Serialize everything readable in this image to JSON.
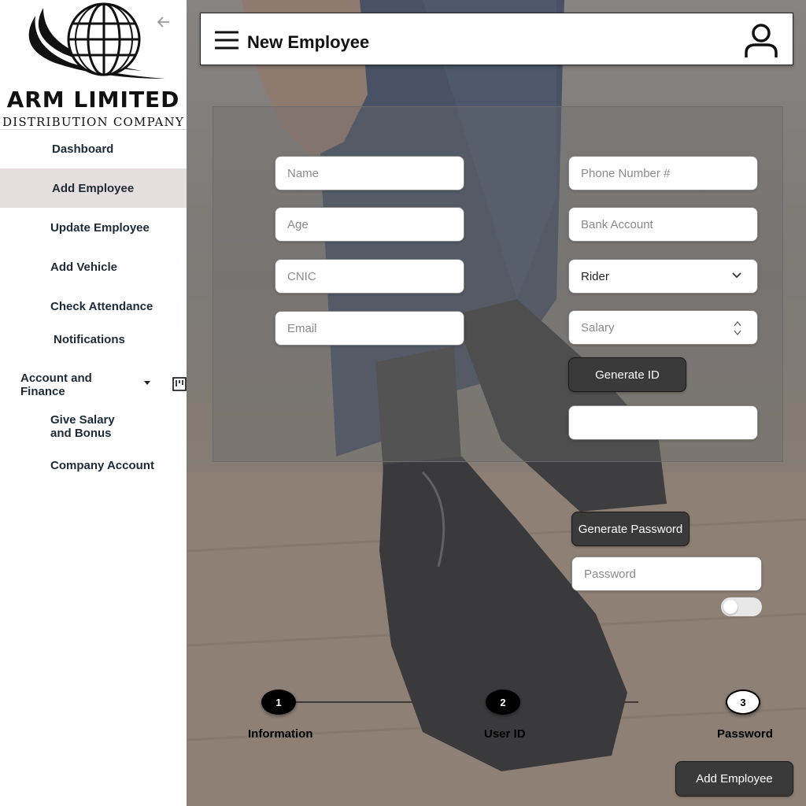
{
  "brand": {
    "name": "ARM LIMITED",
    "subtitle": "DISTRIBUTION COMPANY"
  },
  "sidebar": {
    "items": [
      {
        "label": "Dashboard"
      },
      {
        "label": "Add Employee"
      },
      {
        "label": "Update Employee"
      },
      {
        "label": "Add Vehicle"
      },
      {
        "label": "Check Attendance"
      },
      {
        "label": "Notifications"
      },
      {
        "label": "Account and Finance"
      },
      {
        "label": "Give Salary and Bonus"
      },
      {
        "label": "Company Account"
      }
    ],
    "active": "Add Employee"
  },
  "header": {
    "title": "New Employee"
  },
  "form": {
    "name_placeholder": "Name",
    "age_placeholder": "Age",
    "cnic_placeholder": "CNIC",
    "email_placeholder": "Email",
    "phone_placeholder": "Phone Number #",
    "bank_placeholder": "Bank Account",
    "role_value": "Rider",
    "salary_placeholder": "Salary",
    "generate_id_label": "Generate ID",
    "id_value": "",
    "generate_password_label": "Generate Password",
    "password_placeholder": "Password",
    "show_password": false
  },
  "stepper": {
    "steps": [
      {
        "number": "1",
        "label": "Information",
        "done": true
      },
      {
        "number": "2",
        "label": "User ID",
        "done": true
      },
      {
        "number": "3",
        "label": "Password",
        "done": false
      }
    ]
  },
  "actions": {
    "submit_label": "Add Employee"
  },
  "icons": {
    "back": "arrow-left-icon",
    "menu": "hamburger-menu-icon",
    "user": "user-profile-icon",
    "kanban": "kanban-icon"
  },
  "colors": {
    "active_nav_bg": "#e6dfdf",
    "dark_button": "#3a3a3a"
  }
}
